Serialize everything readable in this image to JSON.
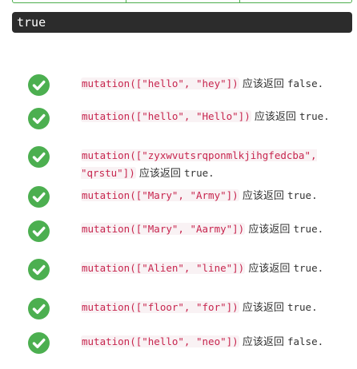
{
  "output": {
    "value": "true"
  },
  "tests": [
    {
      "code": "mutation([\"hello\", \"hey\"])",
      "desc": "应该返回",
      "result": "false."
    },
    {
      "code": "mutation([\"hello\", \"Hello\"])",
      "desc": "应该返回",
      "result": "true."
    },
    {
      "code": "mutation([\"zyxwvutsrqponmlkjihgfedcba\", \"qrstu\"])",
      "desc": "应该返回",
      "result": "true."
    },
    {
      "code": "mutation([\"Mary\", \"Army\"])",
      "desc": "应该返回",
      "result": "true."
    },
    {
      "code": "mutation([\"Mary\", \"Aarmy\"])",
      "desc": "应该返回",
      "result": "true."
    },
    {
      "code": "mutation([\"Alien\", \"line\"])",
      "desc": "应该返回",
      "result": "true."
    },
    {
      "code": "mutation([\"floor\", \"for\"])",
      "desc": "应该返回",
      "result": "true."
    },
    {
      "code": "mutation([\"hello\", \"neo\"])",
      "desc": "应该返回",
      "result": "false."
    }
  ],
  "colors": {
    "check_green": "#4caf50",
    "code_red": "#c7254e",
    "code_bg": "#f9f2f4",
    "output_bg": "#2c2c2c",
    "button_border": "#4cae4c"
  },
  "icons": {
    "pass": "check-circle-icon"
  }
}
